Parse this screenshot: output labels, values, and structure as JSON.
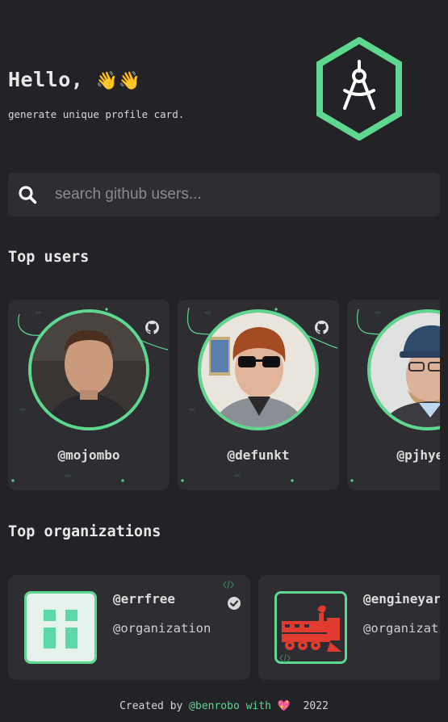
{
  "header": {
    "greeting": "Hello,",
    "greeting_emoji": "👋👋",
    "subtitle": "generate unique profile card."
  },
  "logo": {
    "icon": "compass-hexagon-logo",
    "color": "#5ed88f"
  },
  "search": {
    "placeholder": "search github users...",
    "value": ""
  },
  "sections": {
    "top_users": "Top users",
    "top_organizations": "Top organizations"
  },
  "users": [
    {
      "handle": "@mojombo"
    },
    {
      "handle": "@defunkt"
    },
    {
      "handle": "@pjhyett"
    }
  ],
  "organizations": [
    {
      "handle": "@errfree",
      "type": "@organization"
    },
    {
      "handle": "@engineyard",
      "type": "@organization"
    }
  ],
  "footer": {
    "prefix": "Created by ",
    "author": "@benrobo",
    "with": " with ",
    "heart": "💖",
    "year": "  2022"
  },
  "colors": {
    "accent": "#5ed88f",
    "background": "#232226",
    "card": "#2e2e32"
  }
}
